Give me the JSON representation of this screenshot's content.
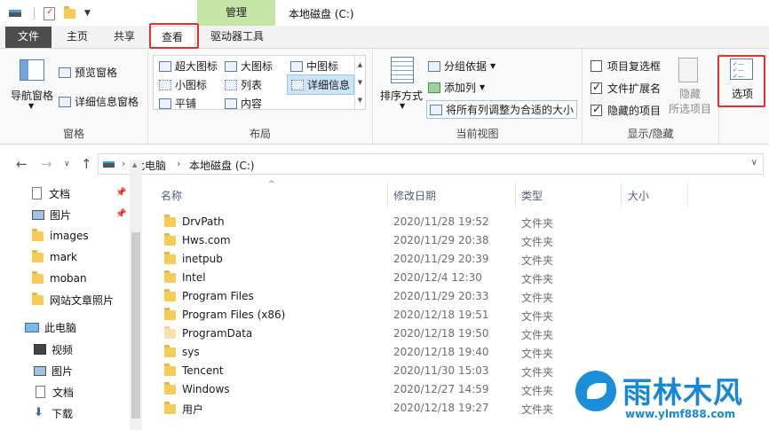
{
  "window": {
    "title": "本地磁盘 (C:)",
    "context_group": "管理"
  },
  "tabs": [
    {
      "label": "文件"
    },
    {
      "label": "主页"
    },
    {
      "label": "共享"
    },
    {
      "label": "查看"
    },
    {
      "label": "驱动器工具"
    }
  ],
  "ribbon": {
    "pane_group": {
      "label": "窗格",
      "nav_pane": "导航窗格",
      "preview_pane": "预览窗格",
      "details_pane": "详细信息窗格"
    },
    "layout_group": {
      "label": "布局",
      "items": [
        "超大图标",
        "大图标",
        "中图标",
        "小图标",
        "列表",
        "详细信息",
        "平铺",
        "内容"
      ],
      "selected": "详细信息"
    },
    "current_view_group": {
      "label": "当前视图",
      "sort_by": "排序方式",
      "group_by": "分组依据",
      "add_column": "添加列",
      "fit_columns": "将所有列调整为合适的大小"
    },
    "show_hide_group": {
      "label": "显示/隐藏",
      "item_checkboxes": "项目复选框",
      "file_extensions": "文件扩展名",
      "hidden_items": "隐藏的项目",
      "hide_selected_1": "隐藏",
      "hide_selected_2": "所选项目",
      "item_checkboxes_checked": false,
      "file_extensions_checked": true,
      "hidden_items_checked": true
    },
    "options": "选项"
  },
  "address": {
    "path": [
      "此电脑",
      "本地磁盘 (C:)"
    ]
  },
  "nav_pane": {
    "items": [
      {
        "label": "文档",
        "icon": "document-icon",
        "pinned": true
      },
      {
        "label": "图片",
        "icon": "pictures-icon",
        "pinned": true
      },
      {
        "label": "images",
        "icon": "folder-icon"
      },
      {
        "label": "mark",
        "icon": "folder-icon"
      },
      {
        "label": "moban",
        "icon": "folder-icon"
      },
      {
        "label": "网站文章照片",
        "icon": "folder-icon"
      },
      {
        "label": "此电脑",
        "icon": "computer-icon"
      },
      {
        "label": "视频",
        "icon": "video-icon"
      },
      {
        "label": "图片",
        "icon": "pictures-icon"
      },
      {
        "label": "文档",
        "icon": "document-icon"
      },
      {
        "label": "下载",
        "icon": "download-icon"
      }
    ]
  },
  "file_list": {
    "columns": [
      "名称",
      "修改日期",
      "类型",
      "大小"
    ],
    "rows": [
      {
        "name": "DrvPath",
        "date": "2020/11/28 19:52",
        "type": "文件夹"
      },
      {
        "name": "Hws.com",
        "date": "2020/11/29 20:38",
        "type": "文件夹"
      },
      {
        "name": "inetpub",
        "date": "2020/11/29 20:39",
        "type": "文件夹"
      },
      {
        "name": "Intel",
        "date": "2020/12/4 12:30",
        "type": "文件夹"
      },
      {
        "name": "Program Files",
        "date": "2020/11/29 20:33",
        "type": "文件夹"
      },
      {
        "name": "Program Files (x86)",
        "date": "2020/12/18 19:51",
        "type": "文件夹"
      },
      {
        "name": "ProgramData",
        "date": "2020/12/18 19:50",
        "type": "文件夹",
        "hidden": true
      },
      {
        "name": "sys",
        "date": "2020/12/18 19:40",
        "type": "文件夹"
      },
      {
        "name": "Tencent",
        "date": "2020/11/30 15:03",
        "type": "文件夹"
      },
      {
        "name": "Windows",
        "date": "2020/12/27 14:59",
        "type": "文件夹"
      },
      {
        "name": "用户",
        "date": "2020/12/18 19:27",
        "type": "文件夹"
      }
    ]
  },
  "watermark": {
    "title": "雨林木风",
    "url": "www.ylmf888.com"
  },
  "colors": {
    "highlight_box": "#e53030",
    "context_tab": "#c6e6a8",
    "file_tab": "#4d4d4d",
    "folder": "#f6cc57",
    "watermark": "#1588d8"
  }
}
